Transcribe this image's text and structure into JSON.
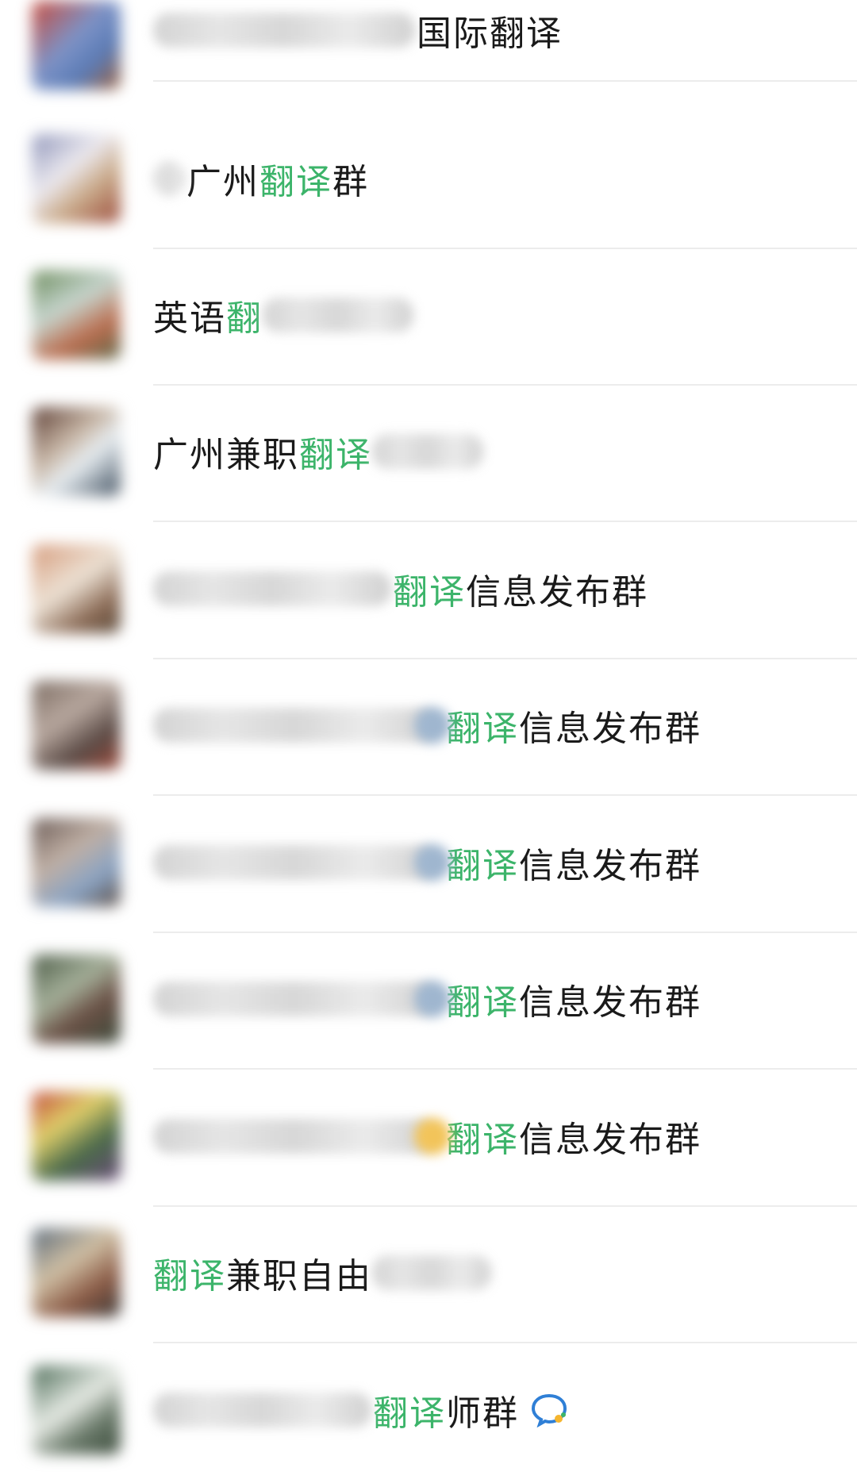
{
  "rows": [
    {
      "name_suffix": "国际翻译"
    },
    {
      "name_a": "广州",
      "hl": "翻译",
      "name_b": "群"
    },
    {
      "name_a": "英语",
      "hl": "翻"
    },
    {
      "name_a": "广州兼职",
      "hl": "翻译"
    },
    {
      "hl": "翻译",
      "name_b": "信息发布群"
    },
    {
      "hl": "翻译",
      "name_b": "信息发布群"
    },
    {
      "hl": "翻译",
      "name_b": "信息发布群"
    },
    {
      "hl": "翻译",
      "name_b": "信息发布群"
    },
    {
      "hl": "翻译",
      "name_b": "信息发布群"
    },
    {
      "hl": "翻译",
      "name_b": "兼职自由"
    },
    {
      "hl": "翻译",
      "name_b": "师群",
      "badge_icon": "enterprise-chat-icon"
    }
  ],
  "colors": {
    "highlight": "#3cb46a",
    "text": "#1a1a1a",
    "divider": "#ececec"
  }
}
